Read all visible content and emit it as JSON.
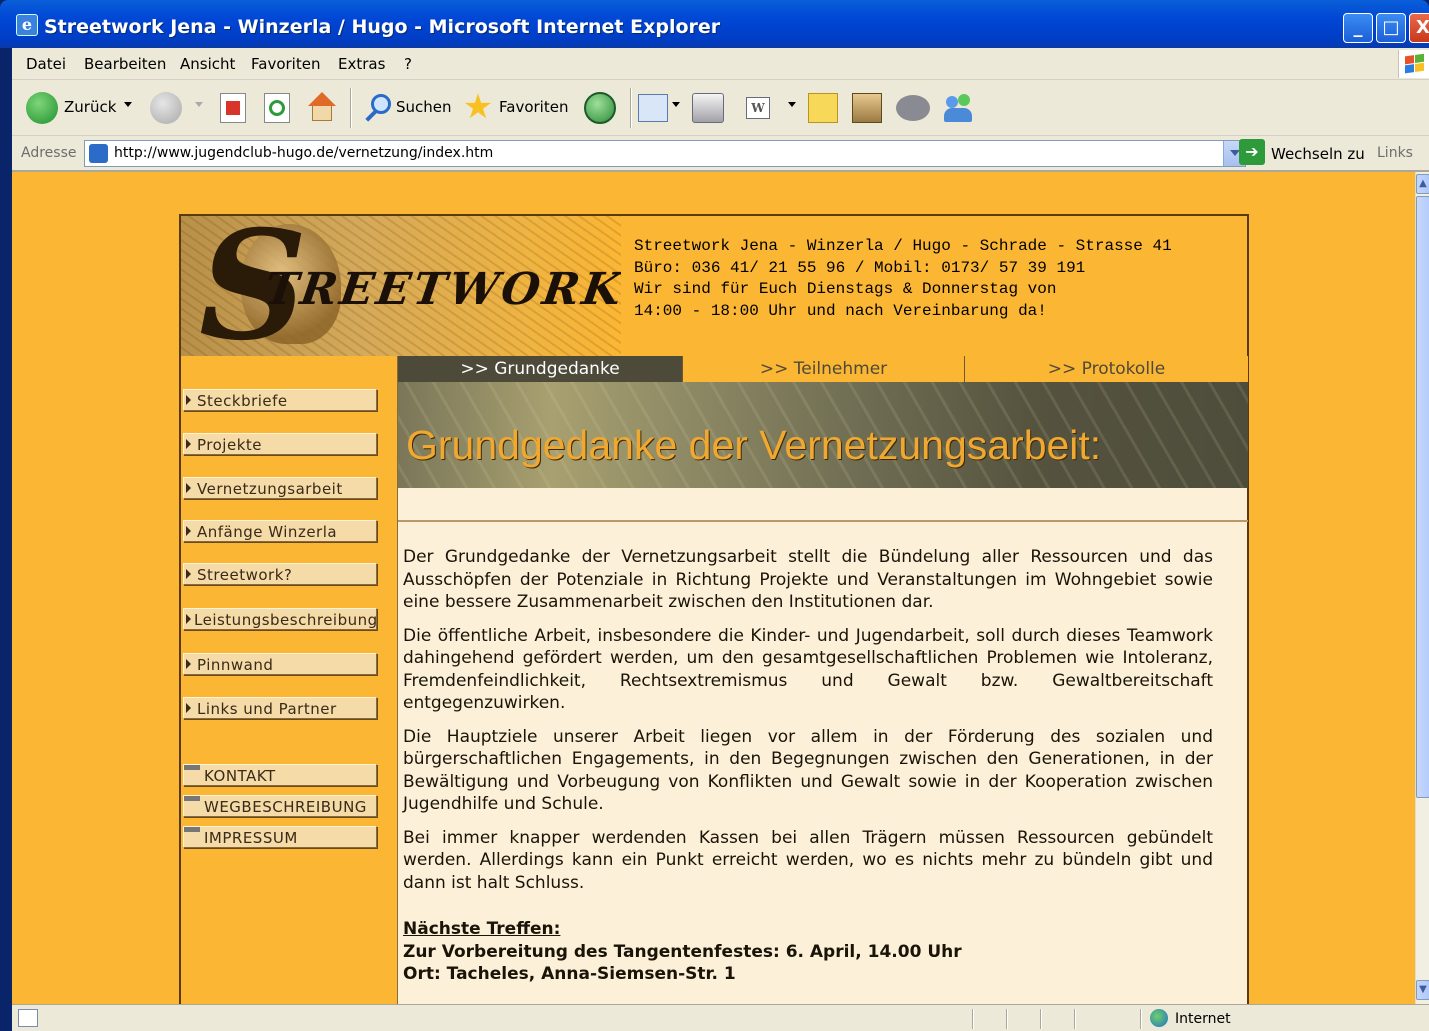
{
  "window": {
    "title": "Streetwork Jena - Winzerla / Hugo - Microsoft Internet Explorer",
    "min_glyph": "_",
    "max_glyph": "□",
    "close_glyph": "X"
  },
  "menu": [
    "Datei",
    "Bearbeiten",
    "Ansicht",
    "Favoriten",
    "Extras",
    "?"
  ],
  "toolbar": {
    "back_label": "Zurück",
    "search_label": "Suchen",
    "favorites_label": "Favoriten"
  },
  "address": {
    "label": "Adresse",
    "url": "http://www.jugendclub-hugo.de/vernetzung/index.htm",
    "go_label": "Wechseln zu",
    "links_label": "Links"
  },
  "status": {
    "zone": "Internet"
  },
  "site": {
    "logo_text": "TREETWORK",
    "logo_initial": "S",
    "contact": [
      "Streetwork Jena - Winzerla / Hugo - Schrade - Strasse 41",
      "Büro: 036 41/ 21 55 96 / Mobil: 0173/ 57 39 191",
      "Wir sind für Euch Dienstags & Donnerstag von",
      "14:00 - 18:00 Uhr und nach Vereinbarung da!"
    ],
    "nav": [
      "Steckbriefe",
      "Projekte",
      "Vernetzungsarbeit",
      "Anfänge Winzerla",
      "Streetwork?",
      "Leistungsbeschreibung",
      "Pinnwand",
      "Links und Partner"
    ],
    "nav_blocks": [
      "KONTAKT",
      "WEGBESCHREIBUNG",
      "IMPRESSUM"
    ],
    "tabs": [
      ">> Grundgedanke",
      ">> Teilnehmer",
      ">> Protokolle"
    ],
    "headline": "Grundgedanke der Vernetzungsarbeit:",
    "paragraphs": [
      "Der Grundgedanke der Vernetzungsarbeit stellt die Bündelung aller Ressourcen und das Ausschöpfen der Potenziale in Richtung Projekte und Veranstaltungen im Wohngebiet sowie eine bessere Zusammenarbeit zwischen den Institutionen dar.",
      "Die öffentliche Arbeit, insbesondere die Kinder- und Jugendarbeit, soll durch dieses Teamwork dahingehend gefördert werden, um den gesamtgesellschaftlichen Problemen wie Intoleranz, Fremdenfeindlichkeit, Rechtsextremismus und Gewalt bzw. Gewaltbereitschaft entgegenzuwirken.",
      "Die Hauptziele unserer Arbeit liegen vor allem in der Förderung des sozialen und bürgerschaftlichen Engagements, in den Begegnungen zwischen den Generationen, in der Bewältigung und Vorbeugung von Konflikten und Gewalt sowie in der Kooperation zwischen Jugendhilfe und Schule.",
      "Bei immer knapper werdenden Kassen bei allen Trägern müssen Ressourcen gebündelt werden. Allerdings kann ein Punkt erreicht werden, wo es nichts mehr zu bündeln gibt und dann ist halt Schluss."
    ],
    "meeting": {
      "heading": "Nächste Treffen:",
      "line1": "Zur Vorbereitung des Tangentenfestes: 6. April, 14.00 Uhr",
      "line2": "Ort: Tacheles, Anna-Siemsen-Str. 1"
    }
  },
  "colors": {
    "page_background": "#fbb633",
    "tab_active": "#4e4a3a",
    "headline": "#f0a830"
  }
}
